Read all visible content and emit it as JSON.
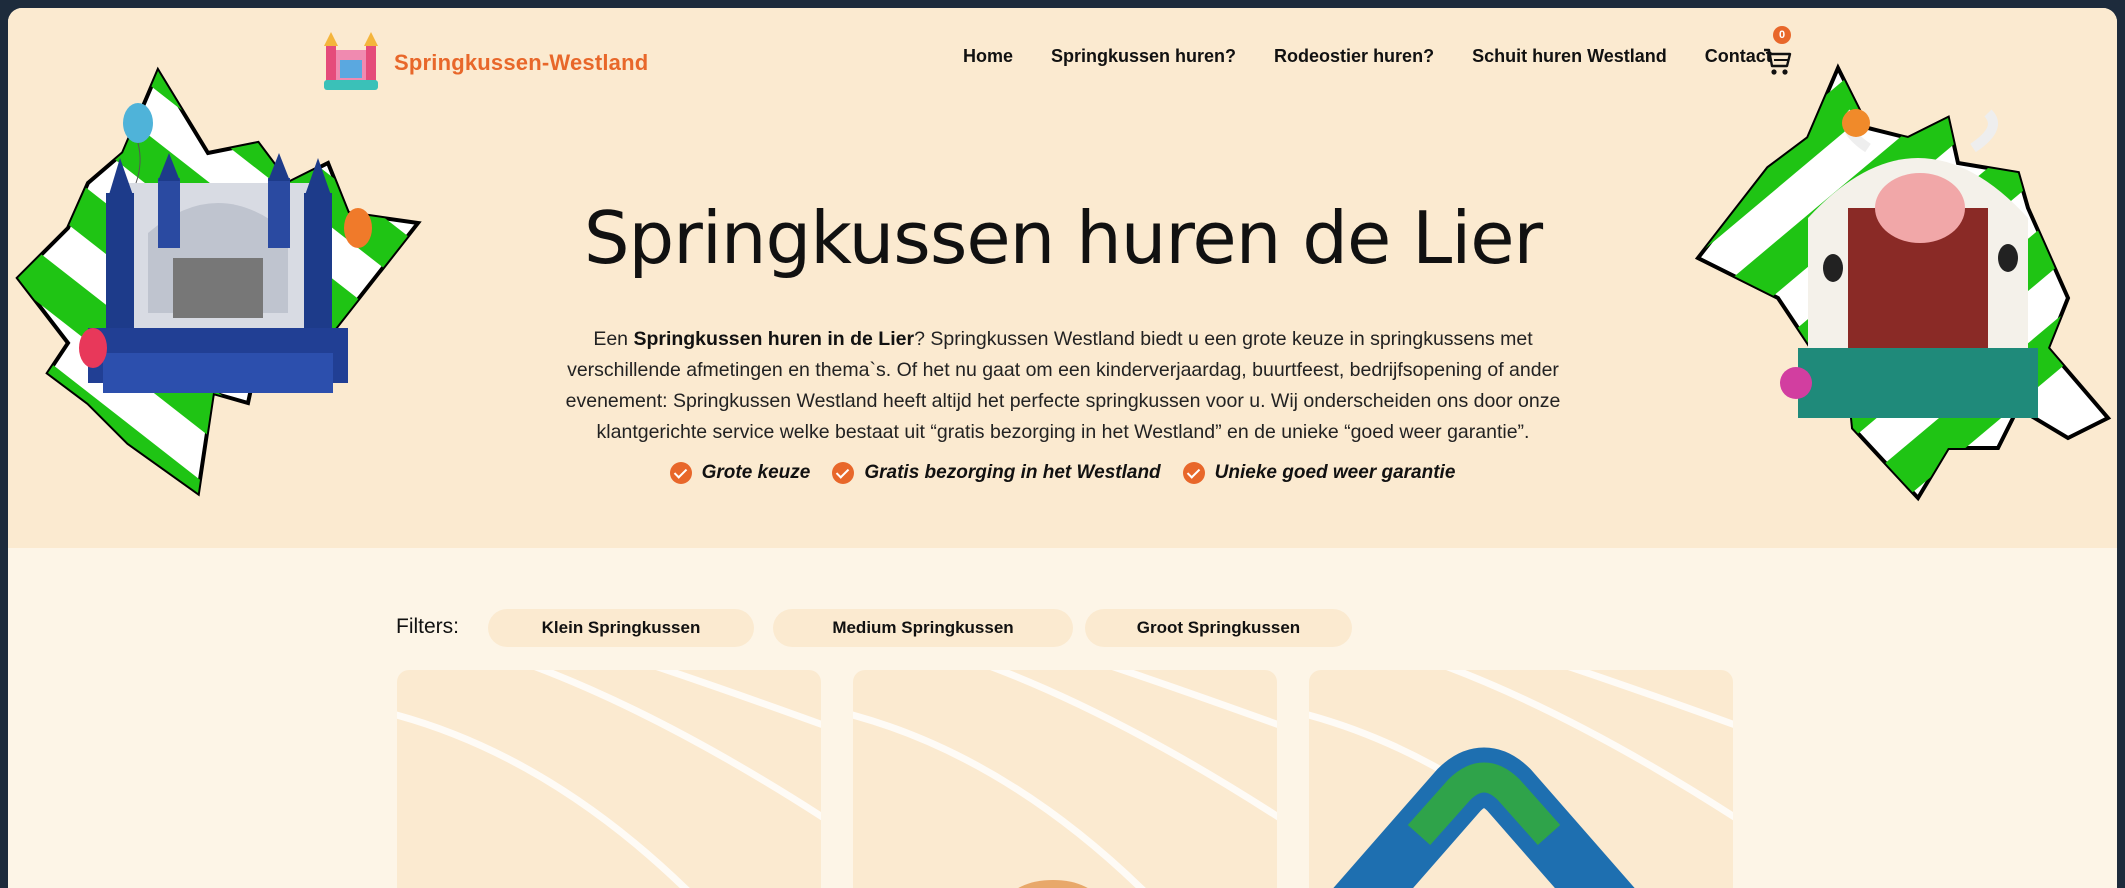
{
  "brand": {
    "name": "Springkussen-Westland"
  },
  "nav": {
    "items": [
      {
        "label": "Home"
      },
      {
        "label": "Springkussen huren?"
      },
      {
        "label": "Rodeostier huren?"
      },
      {
        "label": "Schuit huren Westland"
      },
      {
        "label": "Contact"
      }
    ],
    "cart_count": "0",
    "cart_icon": "cart-icon"
  },
  "hero": {
    "title": "Springkussen huren de Lier",
    "intro_prefix": "Een ",
    "intro_bold": "Springkussen huren in de Lier",
    "intro_rest": "?  Springkussen Westland biedt u een grote keuze in springkussens met verschillende afmetingen en thema`s. Of het nu gaat om een kinderverjaardag, buurtfeest, bedrijfsopening of ander evenement: Springkussen Westland heeft altijd het perfecte springkussen voor u. Wij onderscheiden ons door onze klantgerichte service welke bestaat uit “gratis bezorging in het Westland” en de unieke “goed weer garantie”.",
    "usps": [
      "Grote keuze",
      "Gratis bezorging in het Westland",
      "Unieke goed weer garantie"
    ]
  },
  "filters": {
    "label": "Filters:",
    "options": [
      "Klein Springkussen",
      "Medium Springkussen",
      "Groot Springkussen"
    ]
  },
  "colors": {
    "accent": "#e8672a",
    "hero_bg": "#fbead0",
    "page_bg": "#fdf5e7",
    "green": "#1fc414"
  }
}
